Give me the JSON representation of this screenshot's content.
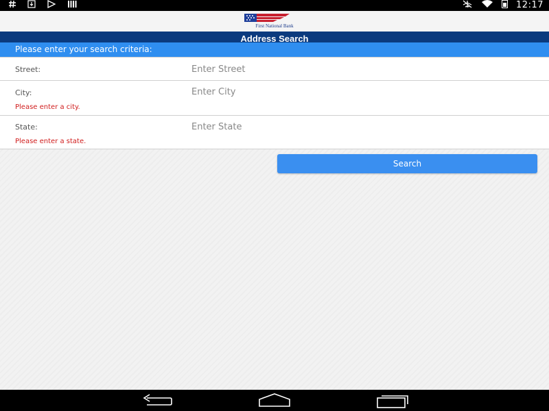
{
  "status_bar": {
    "left_icons": [
      "hash-icon",
      "download-icon",
      "play-store-icon",
      "signal-bars-icon"
    ],
    "right_icons": [
      "airplane-mode-off-icon",
      "wifi-icon",
      "battery-icon"
    ],
    "time": "12:17"
  },
  "logo": {
    "text": "First National Bank"
  },
  "header": {
    "title": "Address Search"
  },
  "criteria": {
    "label": "Please enter your search criteria:"
  },
  "form": {
    "street": {
      "label": "Street:",
      "placeholder": "Enter Street",
      "value": ""
    },
    "city": {
      "label": "City:",
      "placeholder": "Enter City",
      "value": "",
      "error": "Please enter a city."
    },
    "state": {
      "label": "State:",
      "placeholder": "Enter State",
      "value": "",
      "error": "Please enter a state."
    }
  },
  "search_button": {
    "label": "Search"
  },
  "nav_bar": {
    "buttons": [
      "back-icon",
      "home-icon",
      "recent-apps-icon"
    ]
  },
  "colors": {
    "header_bg": "#0b3a7e",
    "criteria_bg": "#2f8ef0",
    "button_bg": "#3a8ff0",
    "error_text": "#d01c1c"
  }
}
